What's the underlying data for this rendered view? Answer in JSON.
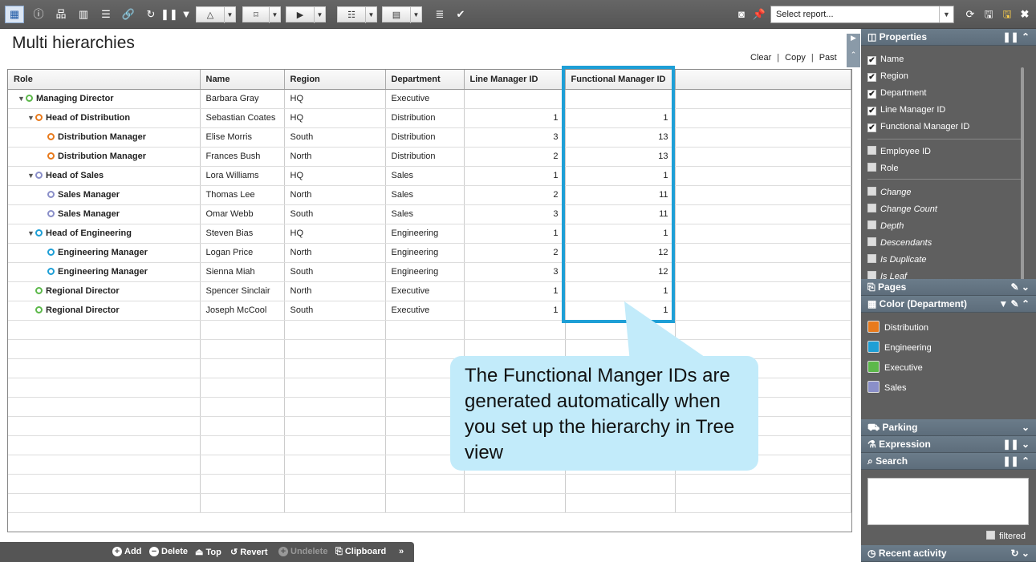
{
  "toolbar": {
    "report_select": "Select report..."
  },
  "page": {
    "title": "Multi hierarchies",
    "links": [
      "Clear",
      "Copy",
      "Past"
    ]
  },
  "grid": {
    "columns": [
      "Role",
      "Name",
      "Region",
      "Department",
      "Line Manager ID",
      "Functional Manager ID"
    ],
    "rows": [
      {
        "role": "Managing Director",
        "level": 0,
        "expanded": true,
        "color": "#5cb84a",
        "name": "Barbara Gray",
        "region": "HQ",
        "department": "Executive",
        "line_manager_id": "",
        "functional_manager_id": ""
      },
      {
        "role": "Head of Distribution",
        "level": 1,
        "expanded": true,
        "color": "#e87a1c",
        "name": "Sebastian Coates",
        "region": "HQ",
        "department": "Distribution",
        "line_manager_id": "1",
        "functional_manager_id": "1"
      },
      {
        "role": "Distribution Manager",
        "level": 2,
        "expanded": false,
        "color": "#e87a1c",
        "name": "Elise Morris",
        "region": "South",
        "department": "Distribution",
        "line_manager_id": "3",
        "functional_manager_id": "13"
      },
      {
        "role": "Distribution Manager",
        "level": 2,
        "expanded": false,
        "color": "#e87a1c",
        "name": "Frances Bush",
        "region": "North",
        "department": "Distribution",
        "line_manager_id": "2",
        "functional_manager_id": "13"
      },
      {
        "role": "Head of Sales",
        "level": 1,
        "expanded": true,
        "color": "#8a8fc9",
        "name": "Lora Williams",
        "region": "HQ",
        "department": "Sales",
        "line_manager_id": "1",
        "functional_manager_id": "1"
      },
      {
        "role": "Sales Manager",
        "level": 2,
        "expanded": false,
        "color": "#8a8fc9",
        "name": "Thomas Lee",
        "region": "North",
        "department": "Sales",
        "line_manager_id": "2",
        "functional_manager_id": "11"
      },
      {
        "role": "Sales Manager",
        "level": 2,
        "expanded": false,
        "color": "#8a8fc9",
        "name": "Omar Webb",
        "region": "South",
        "department": "Sales",
        "line_manager_id": "3",
        "functional_manager_id": "11"
      },
      {
        "role": "Head of Engineering",
        "level": 1,
        "expanded": true,
        "color": "#1e9fd6",
        "name": "Steven Bias",
        "region": "HQ",
        "department": "Engineering",
        "line_manager_id": "1",
        "functional_manager_id": "1"
      },
      {
        "role": "Engineering Manager",
        "level": 2,
        "expanded": false,
        "color": "#1e9fd6",
        "name": "Logan Price",
        "region": "North",
        "department": "Engineering",
        "line_manager_id": "2",
        "functional_manager_id": "12"
      },
      {
        "role": "Engineering Manager",
        "level": 2,
        "expanded": false,
        "color": "#1e9fd6",
        "name": "Sienna Miah",
        "region": "South",
        "department": "Engineering",
        "line_manager_id": "3",
        "functional_manager_id": "12"
      },
      {
        "role": "Regional Director",
        "level": 1,
        "expanded": false,
        "color": "#5cb84a",
        "name": "Spencer Sinclair",
        "region": "North",
        "department": "Executive",
        "line_manager_id": "1",
        "functional_manager_id": "1"
      },
      {
        "role": "Regional Director",
        "level": 1,
        "expanded": false,
        "color": "#5cb84a",
        "name": "Joseph McCool",
        "region": "South",
        "department": "Executive",
        "line_manager_id": "1",
        "functional_manager_id": "1"
      }
    ]
  },
  "callout": {
    "text": "The Functional Manger IDs are generated automatically when you set up the hierarchy in Tree view"
  },
  "bottombar": {
    "add": "Add",
    "delete": "Delete",
    "top": "Top",
    "revert": "Revert",
    "undelete": "Undelete",
    "clipboard": "Clipboard",
    "more": "»"
  },
  "panel": {
    "properties_title": "Properties",
    "checked_props": [
      "Name",
      "Region",
      "Department",
      "Line Manager ID",
      "Functional Manager ID"
    ],
    "unchecked_props": [
      "Employee ID",
      "Role"
    ],
    "computed_props": [
      "Change",
      "Change Count",
      "Depth",
      "Descendants",
      "Is Duplicate",
      "Is Leaf"
    ],
    "pages_title": "Pages",
    "color_title": "Color (Department)",
    "colors": [
      {
        "label": "Distribution",
        "color": "#e87a1c"
      },
      {
        "label": "Engineering",
        "color": "#1e9fd6"
      },
      {
        "label": "Executive",
        "color": "#5cb84a"
      },
      {
        "label": "Sales",
        "color": "#8a8fc9"
      }
    ],
    "parking_title": "Parking",
    "expression_title": "Expression",
    "search_title": "Search",
    "filtered_label": "filtered",
    "recent_title": "Recent activity"
  }
}
